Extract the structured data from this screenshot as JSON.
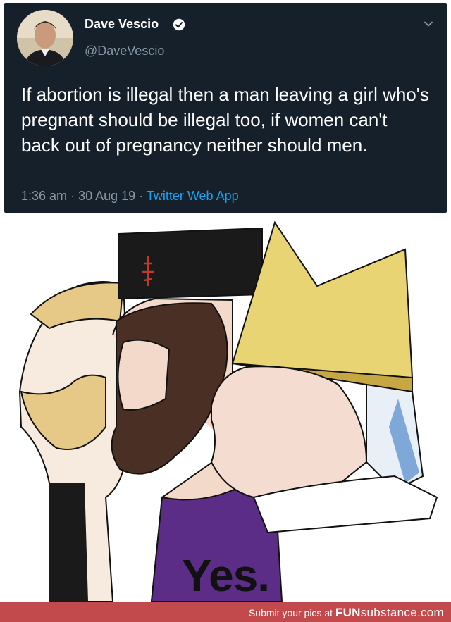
{
  "tweet": {
    "display_name": "Dave Vescio",
    "handle": "@DaveVescio",
    "text": "If abortion is illegal then a man leaving a girl who's pregnant should be illegal too, if women can't back out of pregnancy neither should men.",
    "time": "1:36 am",
    "date": "30 Aug 19",
    "source": "Twitter Web App",
    "separator": "·"
  },
  "meme": {
    "caption": "Yes."
  },
  "footer": {
    "submit_text": "Submit your pics at",
    "brand_bold": "FUN",
    "brand_light": "substance",
    "brand_suffix": ".com"
  },
  "colors": {
    "tweet_bg": "#15202b",
    "link": "#1da1f2",
    "muted": "#8899a6",
    "footer_bg": "#c2494c"
  },
  "icons": [
    "verified-badge-icon",
    "chevron-down-icon"
  ]
}
